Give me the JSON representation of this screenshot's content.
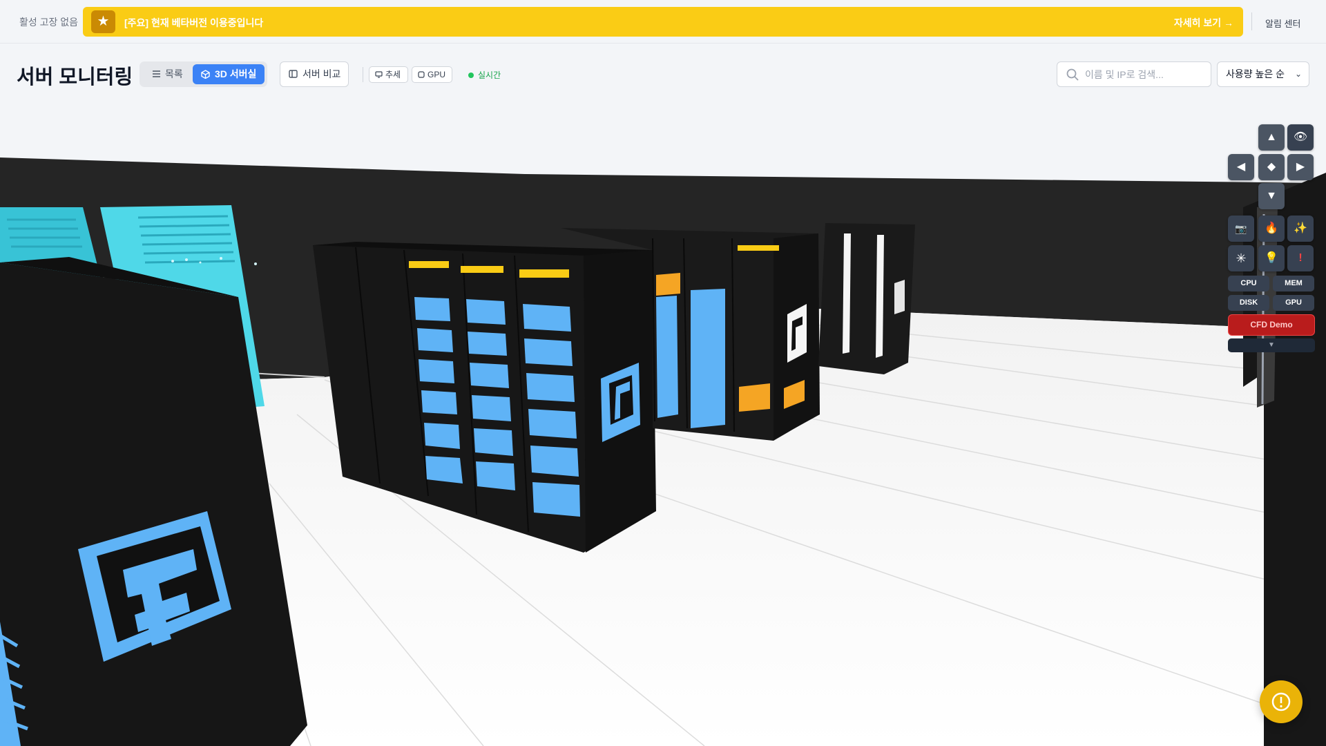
{
  "header": {
    "fault_status": "활성 고장 없음",
    "banner_message": "[주요] 현재 베타버전 이용중입니다",
    "banner_link": "자세히 보기 →",
    "alert_center": "알림 센터",
    "banner_color": "#facc15"
  },
  "toolbar": {
    "title": "서버 모니터링",
    "view_list": "목록",
    "view_3d": "3D 서버실",
    "compare": "서버 비교",
    "chip_trend": "추세",
    "chip_gpu": "GPU",
    "live_label": "실시간",
    "search_placeholder": "이름 및 IP로 검색...",
    "sort_selected": "사용량 높은 순",
    "accent_color": "#3b82f6"
  },
  "controls": {
    "metrics": [
      "CPU",
      "MEM",
      "DISK",
      "GPU"
    ],
    "cfd_demo": "CFD Demo",
    "icons": [
      "arrow-up-icon",
      "eye-icon",
      "arrow-left-icon",
      "center-icon",
      "arrow-right-icon",
      "arrow-down-icon",
      "camera-icon",
      "fire-icon",
      "sparkle-icon",
      "snowflake-icon",
      "bulb-icon",
      "exclamation-icon"
    ]
  },
  "scene": {
    "logo_color": "#60b4f5",
    "rack_color": "#141414",
    "panel_color": "#4fd8e8",
    "warning_color": "#f5a524"
  }
}
